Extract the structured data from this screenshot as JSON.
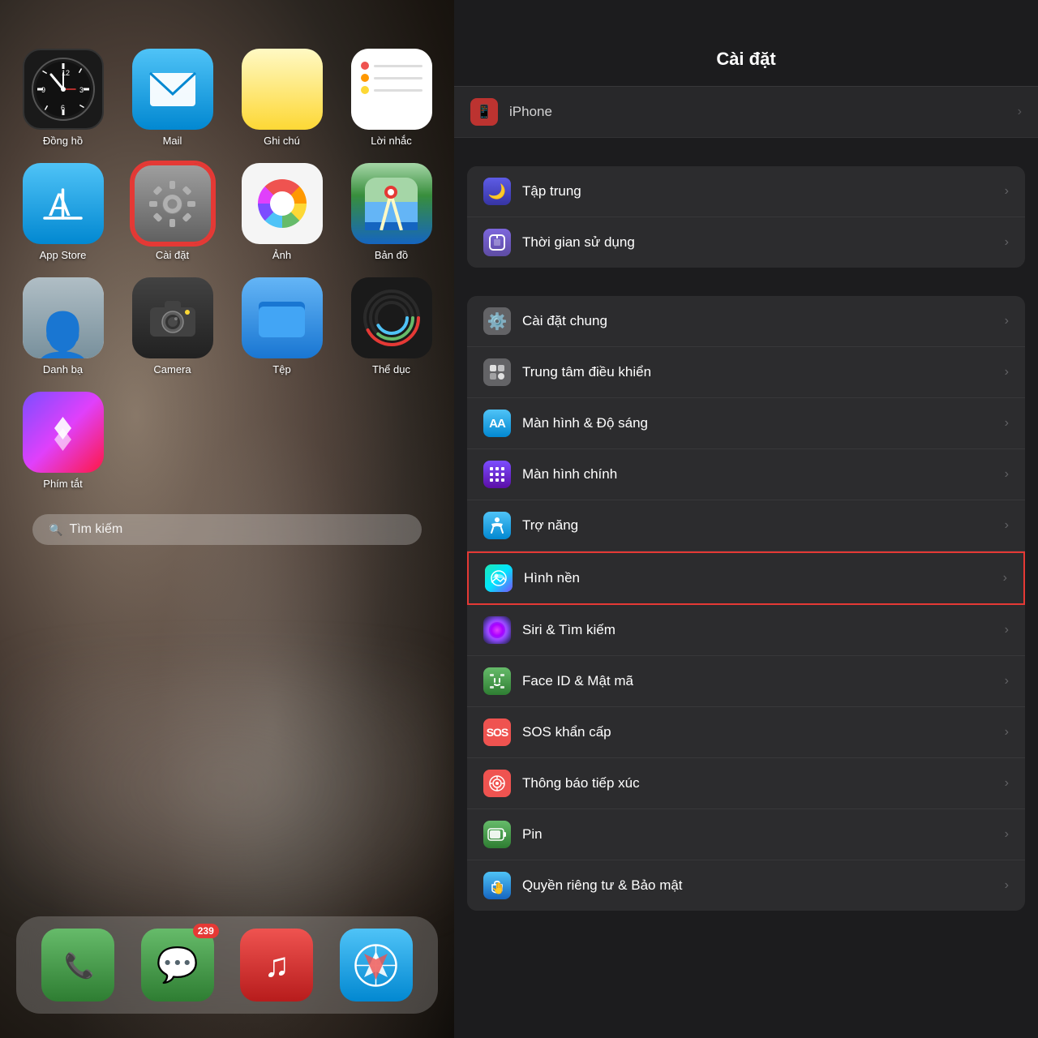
{
  "left": {
    "apps": [
      {
        "id": "clock",
        "label": "Đồng hồ",
        "iconType": "clock"
      },
      {
        "id": "mail",
        "label": "Mail",
        "iconType": "mail"
      },
      {
        "id": "notes",
        "label": "Ghi chú",
        "iconType": "notes"
      },
      {
        "id": "reminders",
        "label": "Lời nhắc",
        "iconType": "reminders"
      },
      {
        "id": "appstore",
        "label": "App Store",
        "iconType": "appstore"
      },
      {
        "id": "settings",
        "label": "Cài đặt",
        "iconType": "settings",
        "highlighted": true
      },
      {
        "id": "photos",
        "label": "Ảnh",
        "iconType": "photos"
      },
      {
        "id": "maps",
        "label": "Bản đồ",
        "iconType": "maps"
      },
      {
        "id": "contacts",
        "label": "Danh bạ",
        "iconType": "contacts"
      },
      {
        "id": "camera",
        "label": "Camera",
        "iconType": "camera"
      },
      {
        "id": "files",
        "label": "Tệp",
        "iconType": "files"
      },
      {
        "id": "fitness",
        "label": "Thể dục",
        "iconType": "fitness"
      },
      {
        "id": "shortcuts",
        "label": "Phím tắt",
        "iconType": "shortcuts"
      }
    ],
    "search": {
      "icon": "🔍",
      "placeholder": "Tìm kiếm"
    },
    "dock": [
      {
        "id": "phone",
        "iconType": "phone",
        "label": "Phone"
      },
      {
        "id": "messages",
        "iconType": "messages",
        "label": "Messages",
        "badge": "239"
      },
      {
        "id": "music",
        "iconType": "music",
        "label": "Music"
      },
      {
        "id": "safari",
        "iconType": "safari",
        "label": "Safari"
      }
    ]
  },
  "right": {
    "title": "Cài đặt",
    "topPeekIcon": "🔴",
    "sections": [
      {
        "items": [
          {
            "id": "focus",
            "icon": "focus",
            "label": "Tập trung",
            "iconColor": "icon-focus",
            "iconSymbol": "🌙"
          },
          {
            "id": "screentime",
            "icon": "screentime",
            "label": "Thời gian sử dụng",
            "iconColor": "icon-screentime",
            "iconSymbol": "⏱"
          }
        ]
      },
      {
        "items": [
          {
            "id": "general",
            "icon": "general",
            "label": "Cài đặt chung",
            "iconColor": "icon-general",
            "iconSymbol": "⚙️"
          },
          {
            "id": "control",
            "icon": "control",
            "label": "Trung tâm điều khiển",
            "iconColor": "icon-control",
            "iconSymbol": "⚙"
          },
          {
            "id": "display",
            "icon": "display",
            "label": "Màn hình & Độ sáng",
            "iconColor": "icon-display",
            "iconSymbol": "AA"
          },
          {
            "id": "homescreen",
            "icon": "homescreen",
            "label": "Màn hình chính",
            "iconColor": "icon-homescreen",
            "iconSymbol": "⠿"
          },
          {
            "id": "accessibility",
            "icon": "accessibility",
            "label": "Trợ năng",
            "iconColor": "icon-accessibility",
            "iconSymbol": "♿"
          },
          {
            "id": "wallpaper",
            "icon": "wallpaper",
            "label": "Hình nền",
            "iconColor": "icon-wallpaper",
            "iconSymbol": "🌸",
            "highlighted": true
          },
          {
            "id": "siri",
            "icon": "siri",
            "label": "Siri & Tìm kiếm",
            "iconColor": "icon-siri",
            "iconSymbol": "◎"
          },
          {
            "id": "faceid",
            "icon": "faceid",
            "label": "Face ID & Mật mã",
            "iconColor": "icon-faceid",
            "iconSymbol": "🙂"
          },
          {
            "id": "sos",
            "icon": "sos",
            "label": "SOS khẩn cấp",
            "iconColor": "icon-sos",
            "iconSymbol": "SOS"
          },
          {
            "id": "exposure",
            "icon": "exposure",
            "label": "Thông báo tiếp xúc",
            "iconColor": "icon-exposure",
            "iconSymbol": "⊙"
          },
          {
            "id": "battery",
            "icon": "battery",
            "label": "Pin",
            "iconColor": "icon-battery",
            "iconSymbol": "🔋"
          },
          {
            "id": "privacy",
            "icon": "privacy",
            "label": "Quyền riêng tư & Bảo mật",
            "iconColor": "icon-privacy",
            "iconSymbol": "✋"
          }
        ]
      }
    ]
  }
}
